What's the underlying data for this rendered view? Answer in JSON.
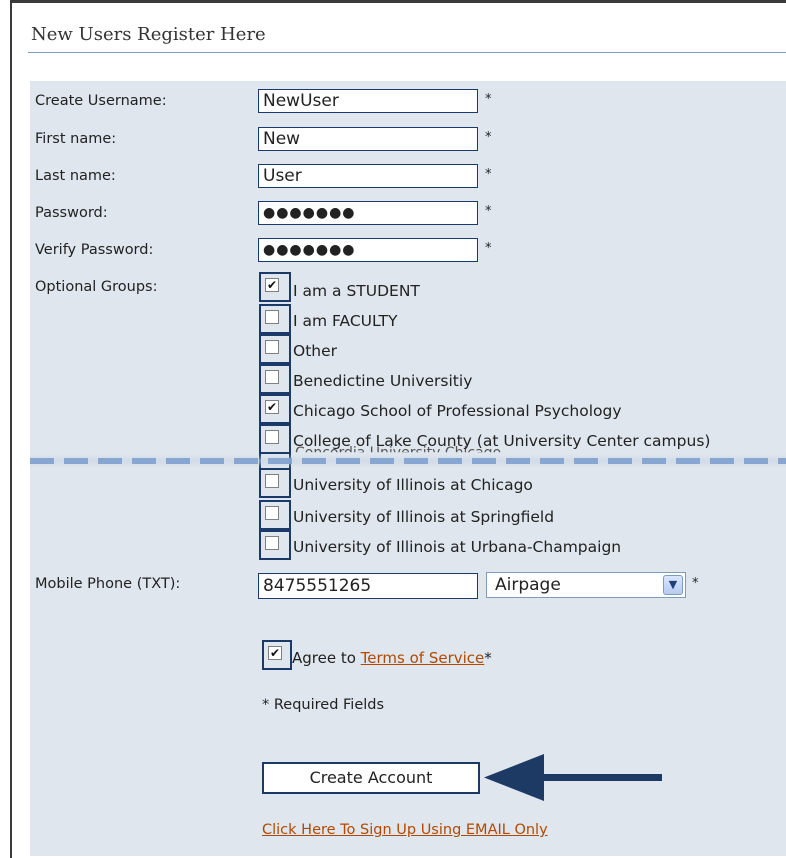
{
  "header": {
    "title": "New Users Register Here"
  },
  "form": {
    "username": {
      "label": "Create Username:",
      "value": "NewUser",
      "required": "*"
    },
    "first_name": {
      "label": "First name:",
      "value": "New",
      "required": "*"
    },
    "last_name": {
      "label": "Last name:",
      "value": "User",
      "required": "*"
    },
    "password": {
      "label": "Password:",
      "value": "●●●●●●●",
      "required": "*"
    },
    "verify_password": {
      "label": "Verify Password:",
      "value": "●●●●●●●",
      "required": "*"
    },
    "groups": {
      "label": "Optional Groups:",
      "check_mark": "✔",
      "items": [
        {
          "label": "I am a STUDENT",
          "checked": true
        },
        {
          "label": "I am FACULTY",
          "checked": false
        },
        {
          "label": "Other",
          "checked": false
        },
        {
          "label": "Benedictine Universitiy",
          "checked": false
        },
        {
          "label": "Chicago School of Professional Psychology",
          "checked": true
        },
        {
          "label": "College of Lake County (at University Center campus)",
          "checked": false
        },
        {
          "label": "Concordia University Chicago",
          "checked": false
        },
        {
          "label": "University of Illinois at Chicago",
          "checked": false
        },
        {
          "label": "University of Illinois at Springfield",
          "checked": false
        },
        {
          "label": "University of Illinois at Urbana-Champaign",
          "checked": false
        }
      ]
    },
    "mobile": {
      "label": "Mobile Phone (TXT):",
      "value": "8475551265",
      "carrier": "Airpage",
      "required": "*"
    },
    "terms": {
      "prefix": "Agree to ",
      "link_text": "Terms of Service",
      "suffix": "*",
      "checked": true
    },
    "required_note": "* Required Fields",
    "create_button": "Create Account",
    "email_link": "Click Here To Sign Up Using EMAIL Only"
  },
  "colors": {
    "panel": "#dfe6ee",
    "border_dark": "#1a3a6a",
    "link": "#b14a00",
    "arrow": "#1c3a64"
  }
}
